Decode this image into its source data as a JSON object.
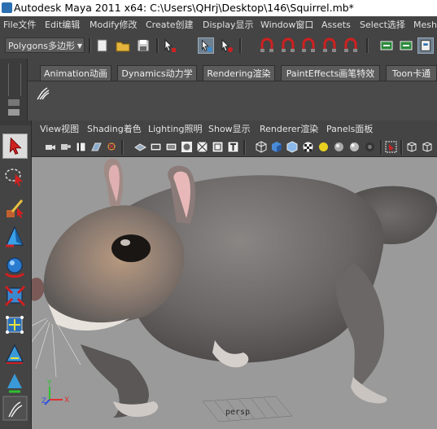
{
  "window": {
    "title": "Autodesk Maya 2011 x64: C:\\Users\\QHrj\\Desktop\\146\\Squirrel.mb*"
  },
  "menu": [
    "File文件",
    "Edit编辑",
    "Modify修改",
    "Create创建",
    "Display显示",
    "Window窗口",
    "Assets",
    "Select选择",
    "Mesh网"
  ],
  "status_line": {
    "mode": "Polygons多边形"
  },
  "shelf": {
    "tabs": [
      "Animation动画",
      "Dynamics动力学",
      "Rendering渲染",
      "PaintEffects画笔特效",
      "Toon卡通"
    ]
  },
  "viewport": {
    "menu": [
      "View视图",
      "Shading着色",
      "Lighting照明",
      "Show显示",
      "Renderer渲染",
      "Panels面板"
    ],
    "camera_label": "persp",
    "axis": {
      "x": "X",
      "y": "Y",
      "z": "Z"
    }
  },
  "colors": {
    "title_bg": "#ffffff",
    "ui_bg": "#444444",
    "viewport_bg": "#9a9a9a",
    "axis_x": "#e03030",
    "axis_y": "#30c030",
    "axis_z": "#3050e0"
  }
}
